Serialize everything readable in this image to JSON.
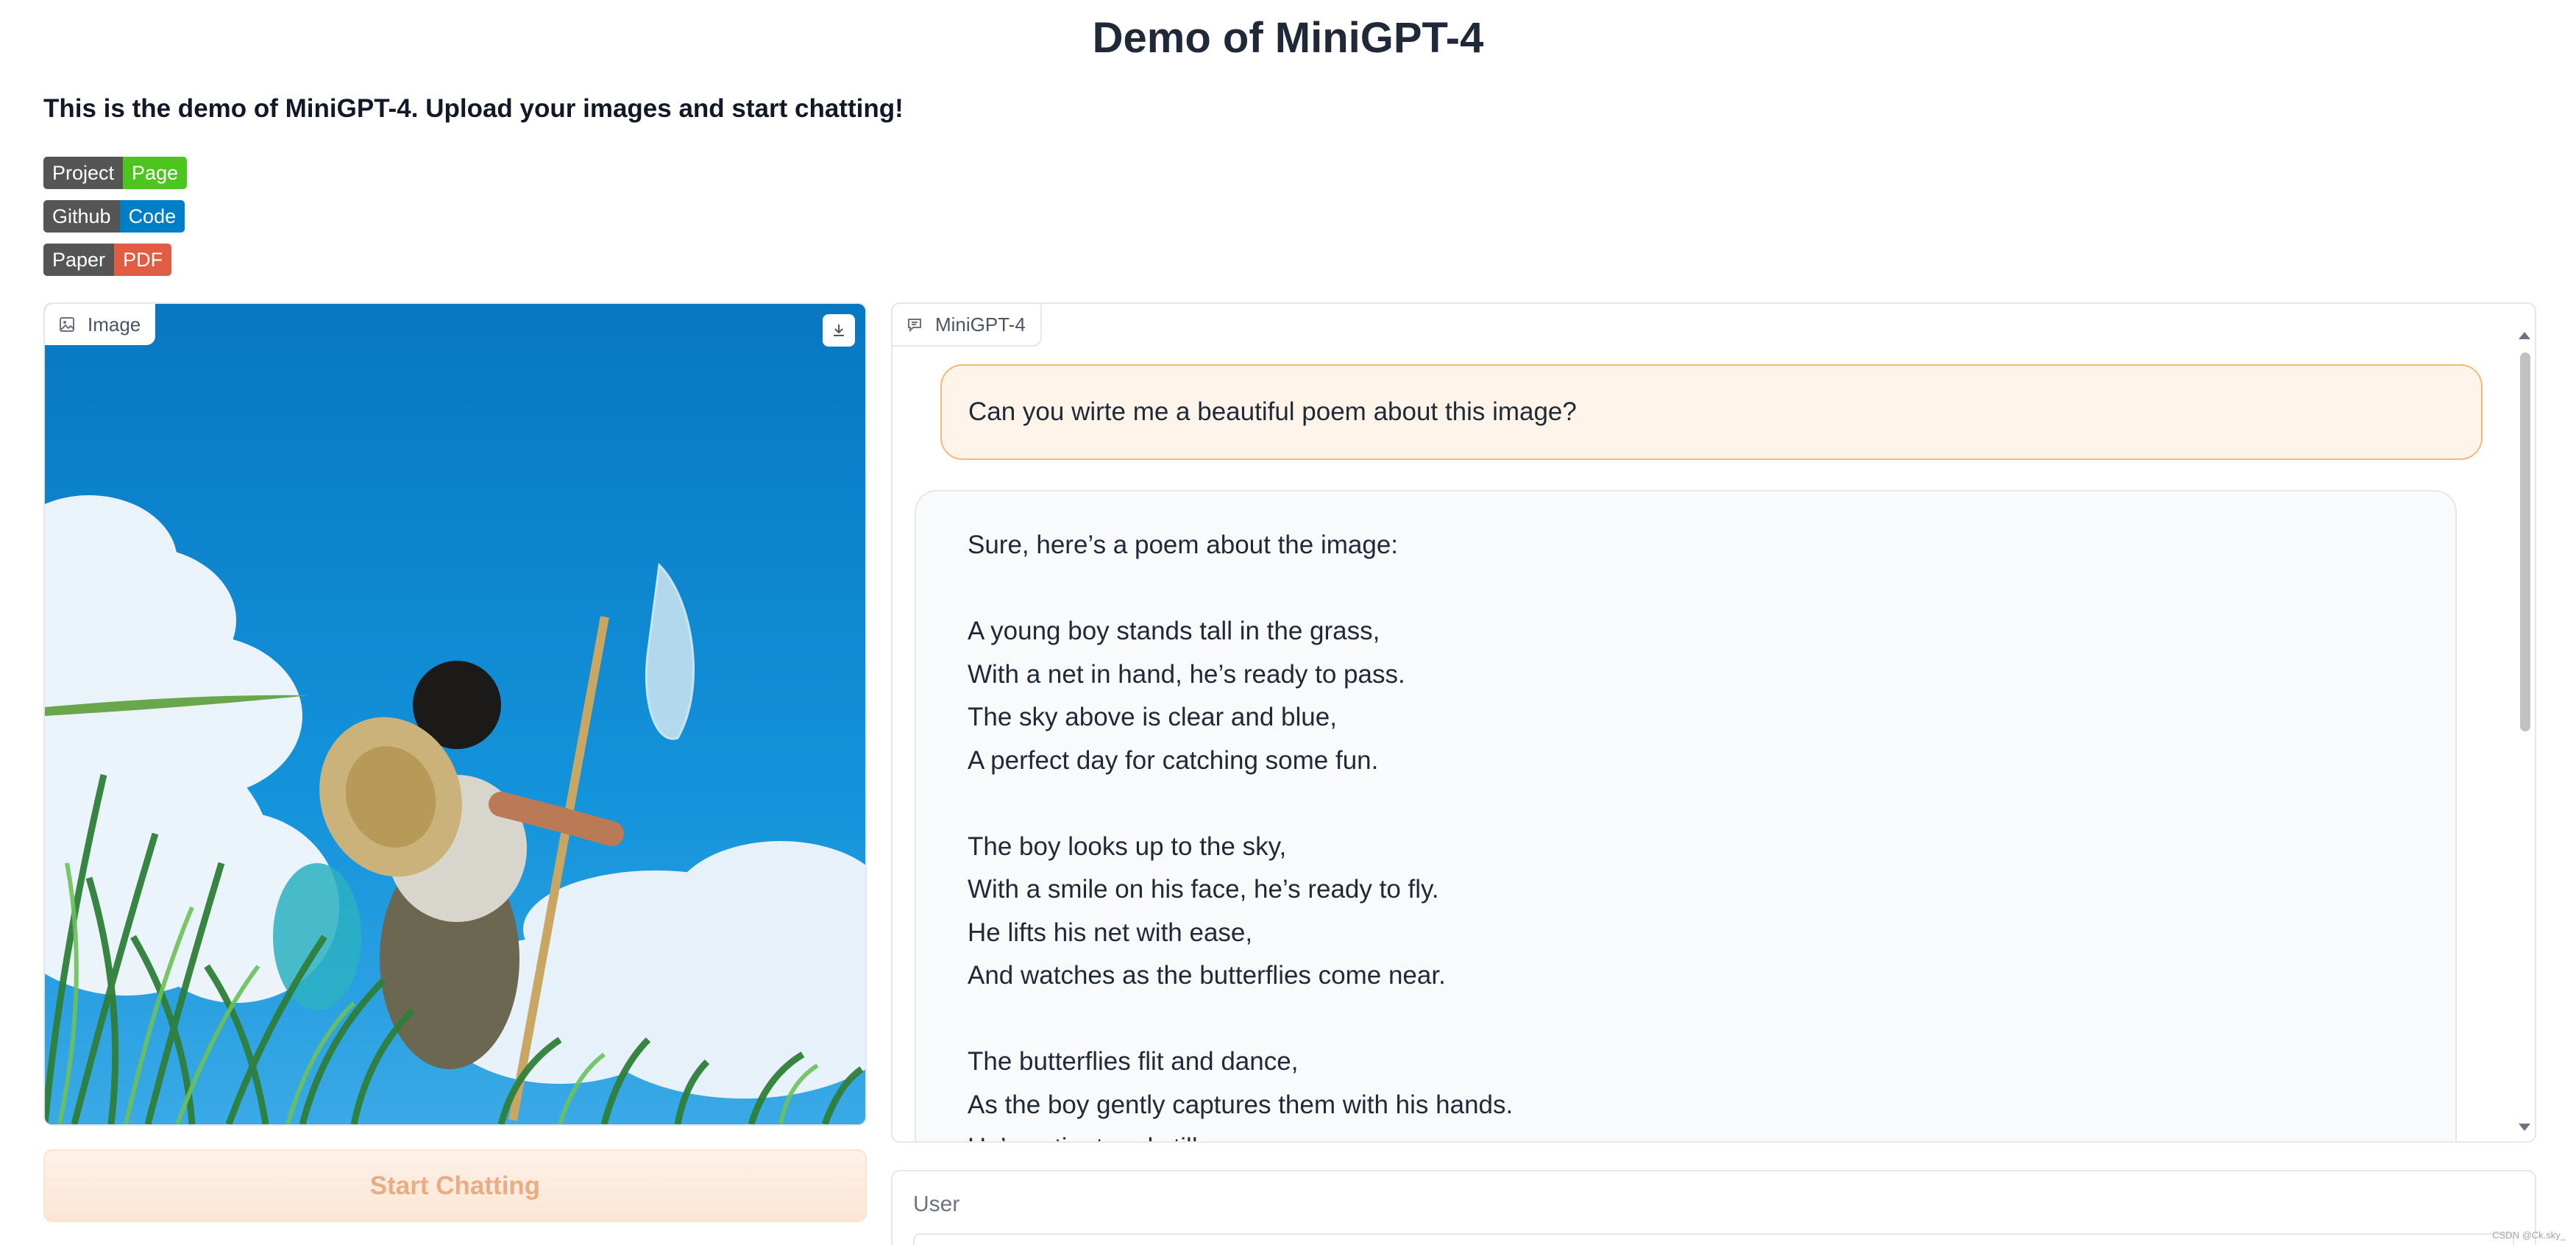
{
  "header": {
    "title": "Demo of MiniGPT-4",
    "description": "This is the demo of MiniGPT-4. Upload your images and start chatting!"
  },
  "badges": [
    {
      "left": "Project",
      "right": "Page",
      "color": "#4cc61e"
    },
    {
      "left": "Github",
      "right": "Code",
      "color": "#007ec6"
    },
    {
      "left": "Paper",
      "right": "PDF",
      "color": "#e05d44"
    }
  ],
  "image_panel": {
    "label": "Image",
    "icon": "image-icon",
    "download_icon": "download-icon"
  },
  "start_button": {
    "label": "Start Chatting"
  },
  "chat": {
    "label": "MiniGPT-4",
    "icon": "chat-icon",
    "user_message": "Can you wirte me a beautiful poem about this image?",
    "bot_lines": [
      "Sure, here’s a poem about the image:",
      "",
      "A young boy stands tall in the grass,",
      "With a net in hand, he’s ready to pass.",
      "The sky above is clear and blue,",
      "A perfect day for catching some fun.",
      "",
      "The boy looks up to the sky,",
      "With a smile on his face, he’s ready to fly.",
      "He lifts his net with ease,",
      "And watches as the butterflies come near.",
      "",
      "The butterflies flit and dance,",
      "As the boy gently captures them with his hands.",
      "He’s patient and still,"
    ]
  },
  "user_panel": {
    "label": "User"
  },
  "watermark": "CSDN @Ck.sky_"
}
